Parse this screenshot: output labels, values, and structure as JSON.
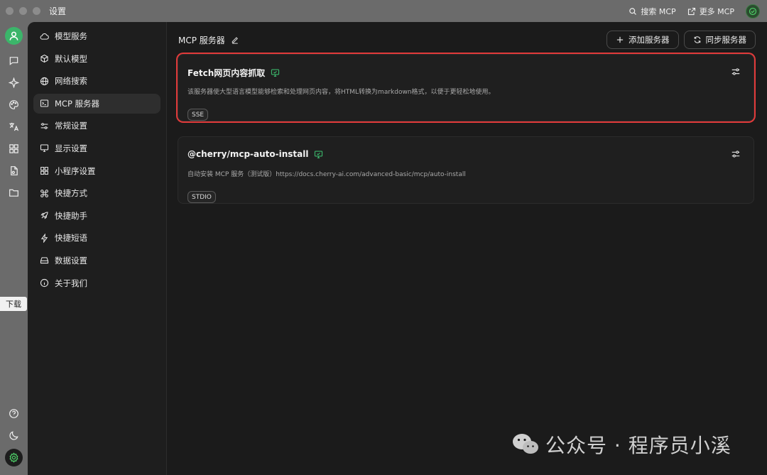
{
  "window": {
    "title": "设置"
  },
  "title_actions": {
    "search_mcp": "搜索 MCP",
    "more_mcp": "更多 MCP"
  },
  "iconbar": {
    "download_tag": "下载"
  },
  "nav": {
    "items": [
      {
        "label": "模型服务",
        "icon": "cloud-icon"
      },
      {
        "label": "默认模型",
        "icon": "cube-icon"
      },
      {
        "label": "网络搜索",
        "icon": "globe-icon"
      },
      {
        "label": "MCP 服务器",
        "icon": "terminal-icon",
        "active": true
      },
      {
        "label": "常规设置",
        "icon": "sliders-icon"
      },
      {
        "label": "显示设置",
        "icon": "monitor-icon"
      },
      {
        "label": "小程序设置",
        "icon": "grid-icon"
      },
      {
        "label": "快捷方式",
        "icon": "command-icon"
      },
      {
        "label": "快捷助手",
        "icon": "rocket-icon"
      },
      {
        "label": "快捷短语",
        "icon": "bolt-icon"
      },
      {
        "label": "数据设置",
        "icon": "drive-icon"
      },
      {
        "label": "关于我们",
        "icon": "info-icon"
      }
    ]
  },
  "content": {
    "title": "MCP 服务器",
    "add_server": "添加服务器",
    "sync_servers": "同步服务器",
    "servers": [
      {
        "name": "Fetch网页内容抓取",
        "description": "该服务器使大型语言模型能够检索和处理网页内容，将HTML转换为markdown格式，以便于更轻松地使用。",
        "tag": "SSE",
        "highlighted": true
      },
      {
        "name": "@cherry/mcp-auto-install",
        "description": "自动安装 MCP 服务（测试版）https://docs.cherry-ai.com/advanced-basic/mcp/auto-install",
        "tag": "STDIO",
        "highlighted": false
      }
    ]
  },
  "watermark": {
    "text": "公众号 · 程序员小溪"
  },
  "colors": {
    "accent_green": "#3bb56a",
    "highlight_red": "#e23a3a",
    "background": "#1b1b1b"
  }
}
